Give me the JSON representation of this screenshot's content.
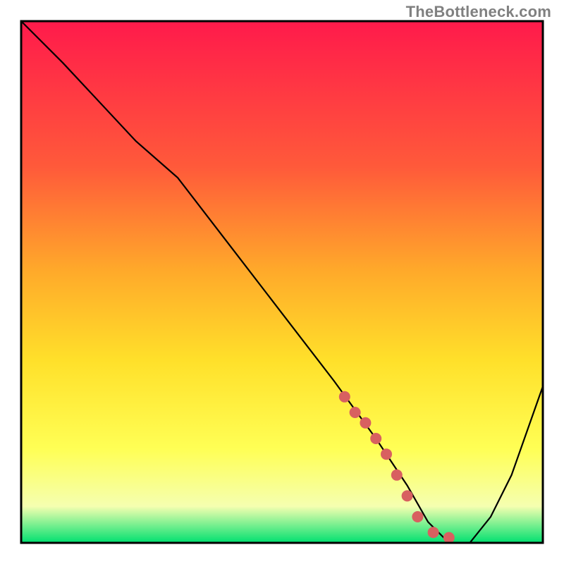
{
  "attribution": "TheBottleneck.com",
  "colors": {
    "border": "#000000",
    "gradient_top": "#ff1a4b",
    "gradient_mid1": "#ff5a3a",
    "gradient_mid2": "#ffaa2a",
    "gradient_mid3": "#ffe02a",
    "gradient_mid4": "#ffff55",
    "gradient_mid5": "#f5ffb0",
    "gradient_bottom": "#00e070",
    "curve": "#000000",
    "marker": "#d86060"
  },
  "chart_data": {
    "type": "line",
    "title": "",
    "xlabel": "",
    "ylabel": "",
    "xlim": [
      0,
      100
    ],
    "ylim": [
      0,
      100
    ],
    "series": [
      {
        "name": "bottleneck-curve",
        "x": [
          0,
          8,
          22,
          30,
          40,
          50,
          60,
          68,
          74,
          78,
          82,
          86,
          90,
          94,
          100
        ],
        "values": [
          100,
          92,
          77,
          70,
          57,
          44,
          31,
          20,
          11,
          4,
          0,
          0,
          5,
          13,
          30
        ]
      }
    ],
    "markers": {
      "name": "highlight-dots",
      "x": [
        62,
        64,
        66,
        68,
        70,
        72,
        74,
        76,
        79,
        82
      ],
      "values": [
        28,
        25,
        23,
        20,
        17,
        13,
        9,
        5,
        2,
        1
      ]
    },
    "grid": false,
    "legend": false
  }
}
